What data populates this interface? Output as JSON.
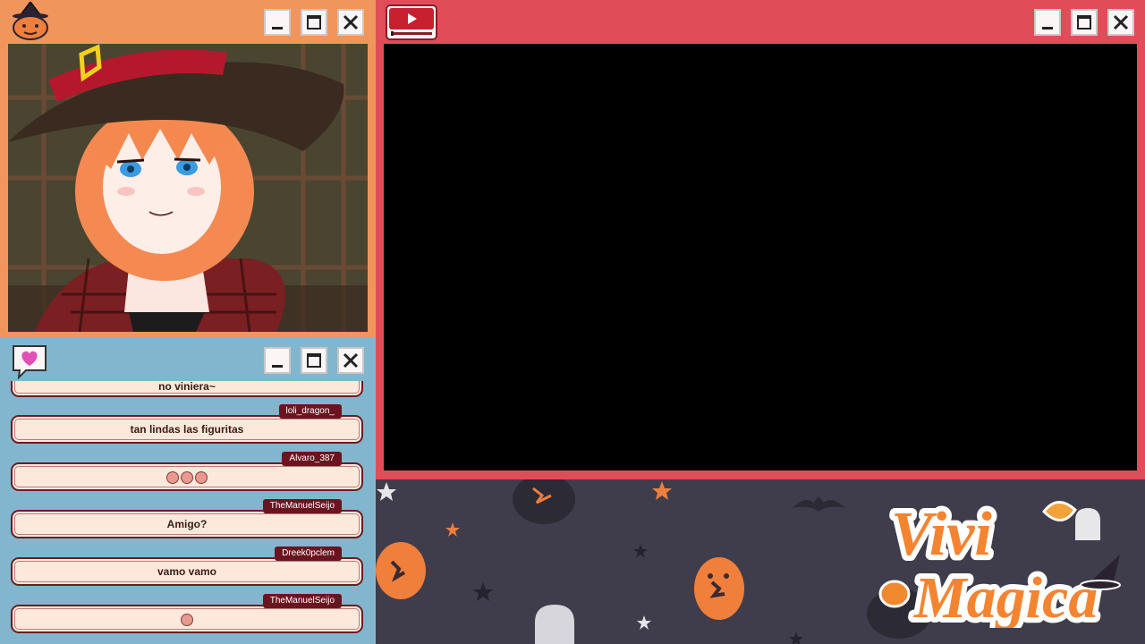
{
  "camera_window": {
    "controls": [
      "minimize",
      "maximize",
      "close"
    ]
  },
  "main_window": {
    "controls": [
      "minimize",
      "maximize",
      "close"
    ]
  },
  "chat": {
    "messages": [
      {
        "user": "",
        "text": "no viniera~"
      },
      {
        "user": "loli_dragon_",
        "text": "tan lindas las figuritas"
      },
      {
        "user": "Alvaro_387",
        "text": "",
        "emotes": 3
      },
      {
        "user": "TheManuelSeijo",
        "text": "Amigo?"
      },
      {
        "user": "Dreek0pclem",
        "text": "vamo vamo"
      },
      {
        "user": "TheManuelSeijo",
        "text": "",
        "emotes": 1
      }
    ]
  },
  "logo": {
    "line1": "Vivi",
    "line2": "Magica"
  },
  "colors": {
    "camera_frame": "#f0955c",
    "main_frame": "#e04d58",
    "chat_frame": "#82b6cf",
    "backdrop": "#3f3d4b",
    "pumpkin": "#f07f3c",
    "chat_bubble": "#fde9dc",
    "username_tag": "#6a1420"
  }
}
